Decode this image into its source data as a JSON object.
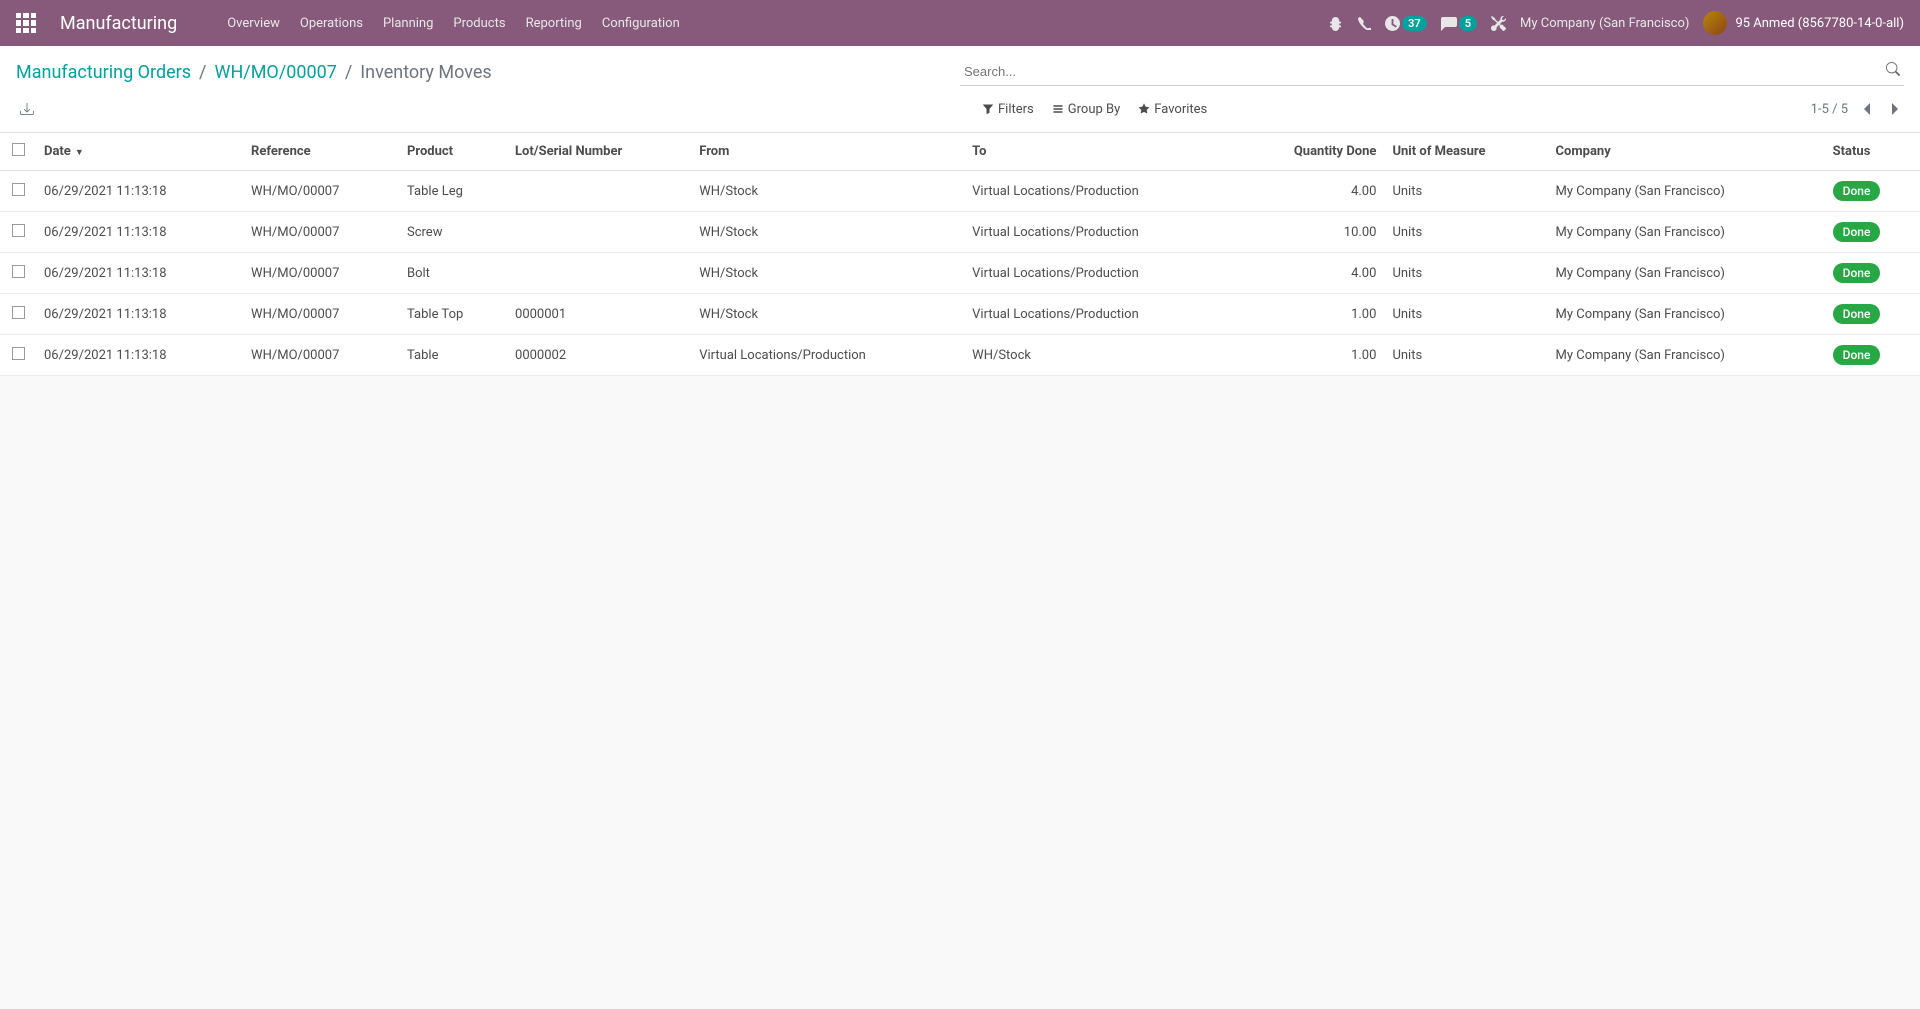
{
  "navbar": {
    "app_title": "Manufacturing",
    "menu": [
      "Overview",
      "Operations",
      "Planning",
      "Products",
      "Reporting",
      "Configuration"
    ],
    "activities_count": "37",
    "messages_count": "5",
    "company": "My Company (San Francisco)",
    "user": "95 Anmed (8567780-14-0-all)"
  },
  "breadcrumb": {
    "items": [
      "Manufacturing Orders",
      "WH/MO/00007"
    ],
    "current": "Inventory Moves"
  },
  "search": {
    "placeholder": "Search..."
  },
  "control": {
    "filters_label": "Filters",
    "groupby_label": "Group By",
    "favorites_label": "Favorites",
    "pager": "1-5 / 5"
  },
  "table": {
    "headers": {
      "date": "Date",
      "reference": "Reference",
      "product": "Product",
      "lot": "Lot/Serial Number",
      "from": "From",
      "to": "To",
      "qty": "Quantity Done",
      "uom": "Unit of Measure",
      "company": "Company",
      "status": "Status"
    },
    "rows": [
      {
        "date": "06/29/2021 11:13:18",
        "reference": "WH/MO/00007",
        "product": "Table Leg",
        "lot": "",
        "from": "WH/Stock",
        "to": "Virtual Locations/Production",
        "qty": "4.00",
        "uom": "Units",
        "company": "My Company (San Francisco)",
        "status": "Done"
      },
      {
        "date": "06/29/2021 11:13:18",
        "reference": "WH/MO/00007",
        "product": "Screw",
        "lot": "",
        "from": "WH/Stock",
        "to": "Virtual Locations/Production",
        "qty": "10.00",
        "uom": "Units",
        "company": "My Company (San Francisco)",
        "status": "Done"
      },
      {
        "date": "06/29/2021 11:13:18",
        "reference": "WH/MO/00007",
        "product": "Bolt",
        "lot": "",
        "from": "WH/Stock",
        "to": "Virtual Locations/Production",
        "qty": "4.00",
        "uom": "Units",
        "company": "My Company (San Francisco)",
        "status": "Done"
      },
      {
        "date": "06/29/2021 11:13:18",
        "reference": "WH/MO/00007",
        "product": "Table Top",
        "lot": "0000001",
        "from": "WH/Stock",
        "to": "Virtual Locations/Production",
        "qty": "1.00",
        "uom": "Units",
        "company": "My Company (San Francisco)",
        "status": "Done"
      },
      {
        "date": "06/29/2021 11:13:18",
        "reference": "WH/MO/00007",
        "product": "Table",
        "lot": "0000002",
        "from": "Virtual Locations/Production",
        "to": "WH/Stock",
        "qty": "1.00",
        "uom": "Units",
        "company": "My Company (San Francisco)",
        "status": "Done"
      }
    ]
  }
}
